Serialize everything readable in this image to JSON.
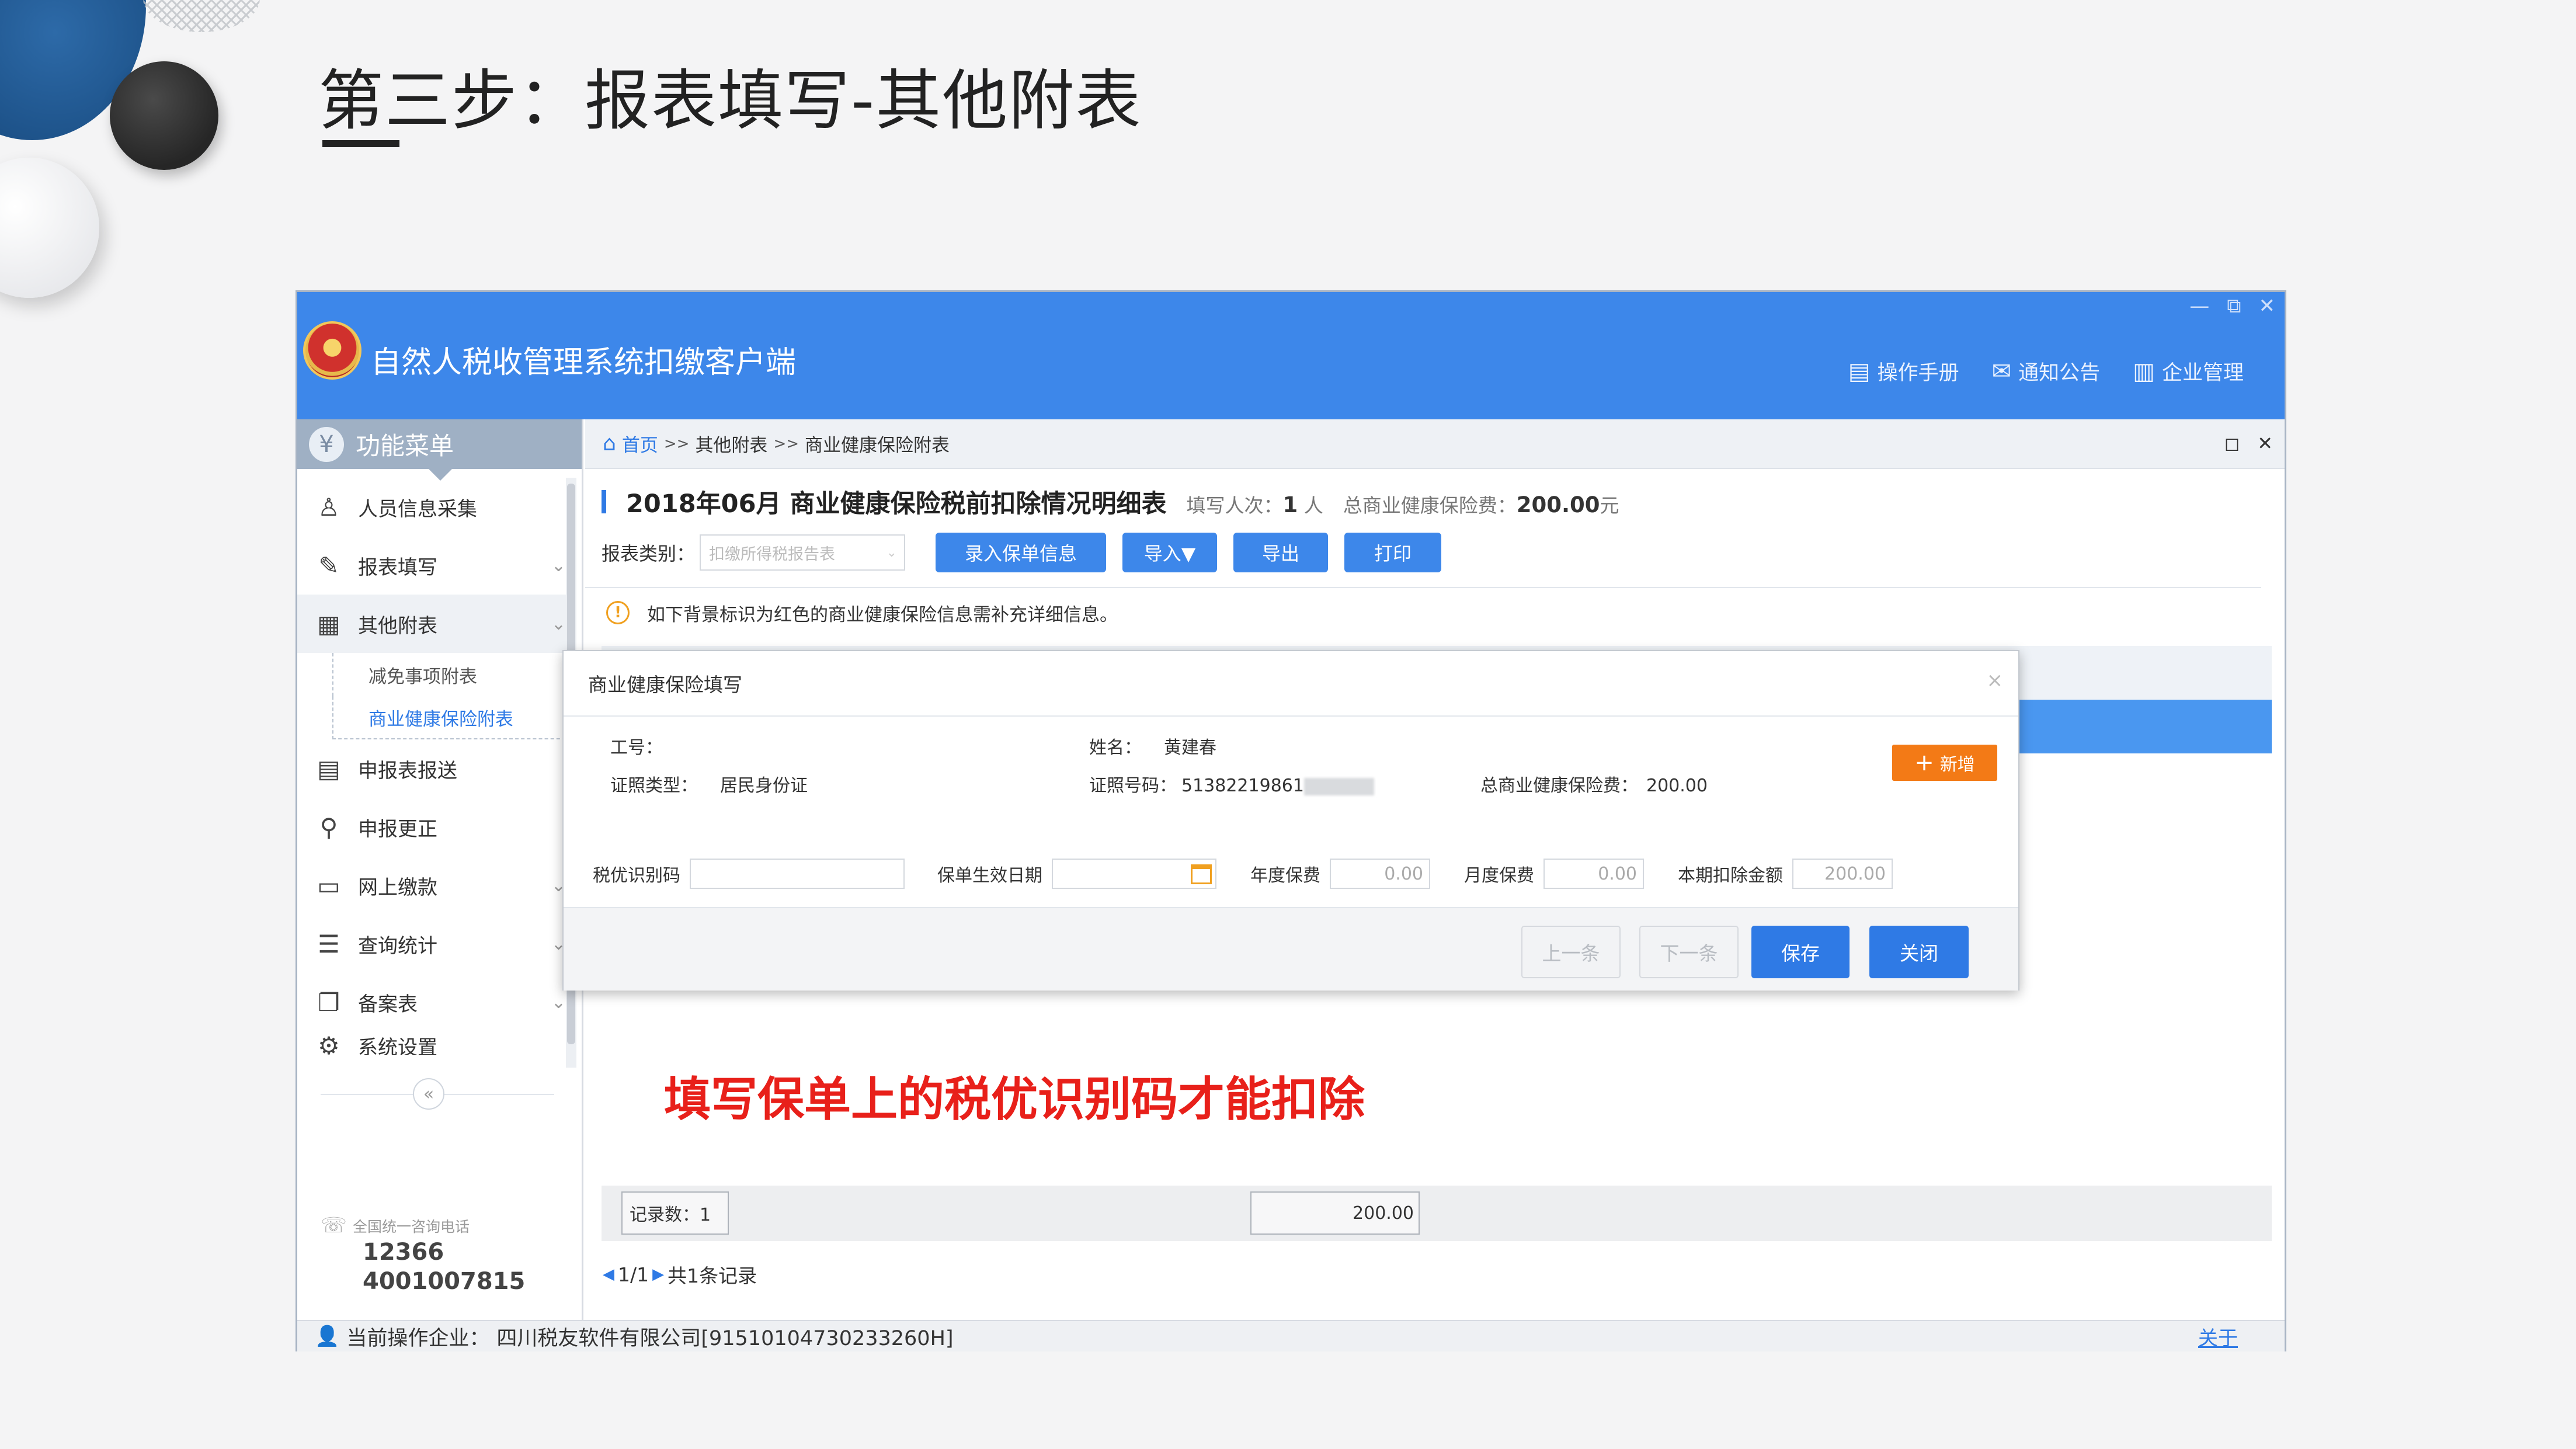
{
  "slide": {
    "title": "第三步：报表填写-其他附表"
  },
  "window": {
    "app_title": "自然人税收管理系统扣缴客户端",
    "controls": {
      "minimize": "—",
      "restore": "⧉",
      "close": "✕"
    },
    "top_nav": [
      {
        "label": "操作手册",
        "icon": "manual-icon"
      },
      {
        "label": "通知公告",
        "icon": "mail-icon"
      },
      {
        "label": "企业管理",
        "icon": "building-icon"
      }
    ]
  },
  "sidebar": {
    "header": "功能菜单",
    "items": [
      {
        "label": "人员信息采集",
        "icon": "person-icon"
      },
      {
        "label": "报表填写",
        "icon": "edit-icon"
      },
      {
        "label": "其他附表",
        "icon": "grid-icon"
      },
      {
        "label": "申报表报送",
        "icon": "report-send-icon"
      },
      {
        "label": "申报更正",
        "icon": "search-icon"
      },
      {
        "label": "网上缴款",
        "icon": "folder-icon"
      },
      {
        "label": "查询统计",
        "icon": "query-icon"
      },
      {
        "label": "备案表",
        "icon": "copy-icon"
      },
      {
        "label": "系统设置",
        "icon": "gear-icon"
      }
    ],
    "submenu": [
      {
        "label": "减免事项附表"
      },
      {
        "label": "商业健康保险附表"
      }
    ],
    "collapse": "«",
    "hotline_label": "全国统一咨询电话",
    "hotline_numbers": [
      "12366",
      "4001007815"
    ]
  },
  "content": {
    "breadcrumb": {
      "home": "首页",
      "sep": ">>",
      "level1": "其他附表",
      "level2": "商业健康保险附表"
    },
    "panel_controls": {
      "maximize": "◻",
      "close": "✕"
    },
    "report": {
      "title": "2018年06月  商业健康保险税前扣除情况明细表",
      "count_label": "填写人次：",
      "count_value": "1",
      "count_unit": "人",
      "total_label": "总商业健康保险费：",
      "total_value": "200.00",
      "total_unit": "元"
    },
    "toolbar": {
      "category_label": "报表类别：",
      "category_value": "扣缴所得税报告表",
      "buttons": {
        "enter_policy": "录入保单信息",
        "import": "导入▼",
        "export": "导出",
        "print": "打印"
      }
    },
    "tip": "如下背景标识为红色的商业健康保险信息需补充详细信息。",
    "annotation": "填写保单上的税优识别码才能扣除",
    "footer": {
      "record_count": "记录数：1",
      "total": "200.00"
    },
    "pager": {
      "page": "1/1",
      "records": "共1条记录"
    }
  },
  "statusbar": {
    "label": "当前操作企业：",
    "company": "四川税友软件有限公司[91510104730233260H]",
    "about": "关于"
  },
  "modal": {
    "title": "商业健康保险填写",
    "close": "×",
    "fields": {
      "job_no_label": "工号：",
      "name_label": "姓名：",
      "name_value": "黄建春",
      "id_type_label": "证照类型：",
      "id_type_value": "居民身份证",
      "id_no_label": "证照号码：",
      "id_no_value": "51382219861",
      "total_label": "总商业健康保险费：",
      "total_value": "200.00"
    },
    "add_button": "新增",
    "row": {
      "tax_code_label": "税优识别码",
      "tax_code_value": "",
      "effective_date_label": "保单生效日期",
      "effective_date_value": "",
      "annual_label": "年度保费",
      "annual_value": "0.00",
      "monthly_label": "月度保费",
      "monthly_value": "0.00",
      "deduct_label": "本期扣除金额",
      "deduct_value": "200.00"
    },
    "buttons": {
      "prev": "上一条",
      "next": "下一条",
      "save": "保存",
      "close": "关闭"
    }
  },
  "colors": {
    "titlebar": "#3d87ea",
    "primary_button": "#2f7ae5",
    "add_button": "#f37a16",
    "annotation": "#e8201a",
    "selected_row": "#4a97f0"
  }
}
